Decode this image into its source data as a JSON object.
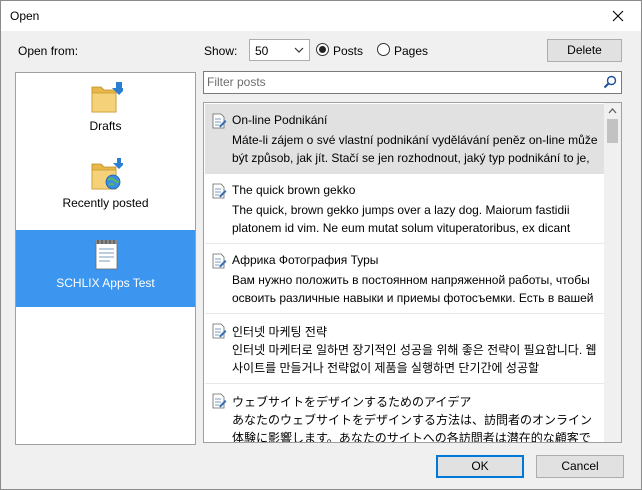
{
  "window": {
    "title": "Open"
  },
  "sidebar": {
    "label": "Open from:",
    "items": [
      {
        "label": "Drafts",
        "icon": "drafts-folder-icon"
      },
      {
        "label": "Recently posted",
        "icon": "recently-posted-folder-icon"
      },
      {
        "label": "SCHLIX Apps Test",
        "icon": "blog-notepad-icon",
        "selected": true
      }
    ]
  },
  "toolbar": {
    "show_label": "Show:",
    "show_value": "50",
    "posts_label": "Posts",
    "pages_label": "Pages",
    "selected_type": "Posts",
    "delete_label": "Delete"
  },
  "filter": {
    "placeholder": "Filter posts"
  },
  "posts": [
    {
      "title": "On-line Podnikání",
      "excerpt": "Máte-li zájem o své vlastní podnikání vydělávání peněz on-line může být způsob, jak jít. Stačí se jen rozhodnout, jaký typ podnikání to je,",
      "selected": true
    },
    {
      "title": "The quick brown gekko",
      "excerpt": "The quick, brown gekko jumps over a lazy dog. Maiorum fastidii platonem id vim. Ne eum mutat solum vituperatoribus, ex dicant"
    },
    {
      "title": "Африка Фотография Туры",
      "excerpt": "Вам нужно положить в постоянном напряженной работы, чтобы освоить различные навыки и приемы фотосъемки. Есть в вашей"
    },
    {
      "title": "인터넷 마케팅 전략",
      "excerpt": "인터넷 마케터로 일하면 장기적인 성공을 위해 좋은 전략이 필요합니다. 웹 사이트를 만들거나 전략없이 제품을 실행하면 단기간에 성공할"
    },
    {
      "title": "ウェブサイトをデザインするためのアイデア",
      "excerpt": "あなたのウェブサイトをデザインする方法は、訪問者のオンライン体験に影響します。あなたのサイトへの各訪問者は潜在的な顧客であるため、あなたのウェブサ"
    }
  ],
  "buttons": {
    "ok": "OK",
    "cancel": "Cancel"
  },
  "colors": {
    "selected_source": "#3c96f0",
    "selected_post": "#e1e1e1",
    "default_button_border": "#0078d7"
  }
}
